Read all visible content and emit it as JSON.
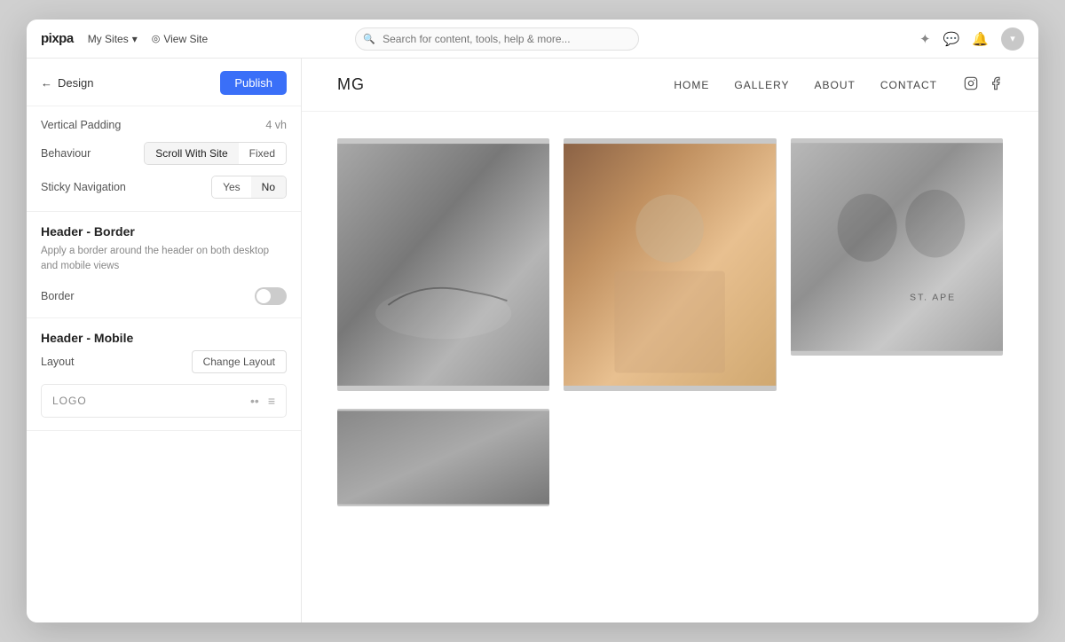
{
  "topbar": {
    "logo": "pixpa",
    "mysites_label": "My Sites",
    "viewsite_label": "View Site",
    "search_placeholder": "Search for content, tools, help & more...",
    "chevron_icon": "▾",
    "eye_icon": "◎"
  },
  "panel": {
    "back_label": "Design",
    "publish_label": "Publish",
    "vertical_padding_label": "Vertical Padding",
    "vertical_padding_value": "4 vh",
    "behaviour_label": "Behaviour",
    "behaviour_options": [
      "Scroll With Site",
      "Fixed"
    ],
    "behaviour_active": "Scroll With Site",
    "sticky_nav_label": "Sticky Navigation",
    "sticky_nav_options": [
      "Yes",
      "No"
    ],
    "sticky_nav_active": "No",
    "border_section_title": "Header - Border",
    "border_section_desc": "Apply a border around the header on both desktop and mobile views",
    "border_label": "Border",
    "mobile_section_title": "Header - Mobile",
    "layout_label": "Layout",
    "change_layout_label": "Change Layout",
    "logo_label": "LOGO"
  },
  "site": {
    "logo": "MG",
    "nav": [
      "HOME",
      "GALLERY",
      "ABOUT",
      "CONTACT"
    ],
    "instagram_icon": "instagram",
    "facebook_icon": "facebook"
  },
  "icons": {
    "search": "🔍",
    "sun": "✦",
    "chat": "💬",
    "bell": "🔔",
    "back_arrow": "←",
    "eye": "◎",
    "chevron": "▾",
    "dots": "••",
    "hamburger": "≡"
  }
}
